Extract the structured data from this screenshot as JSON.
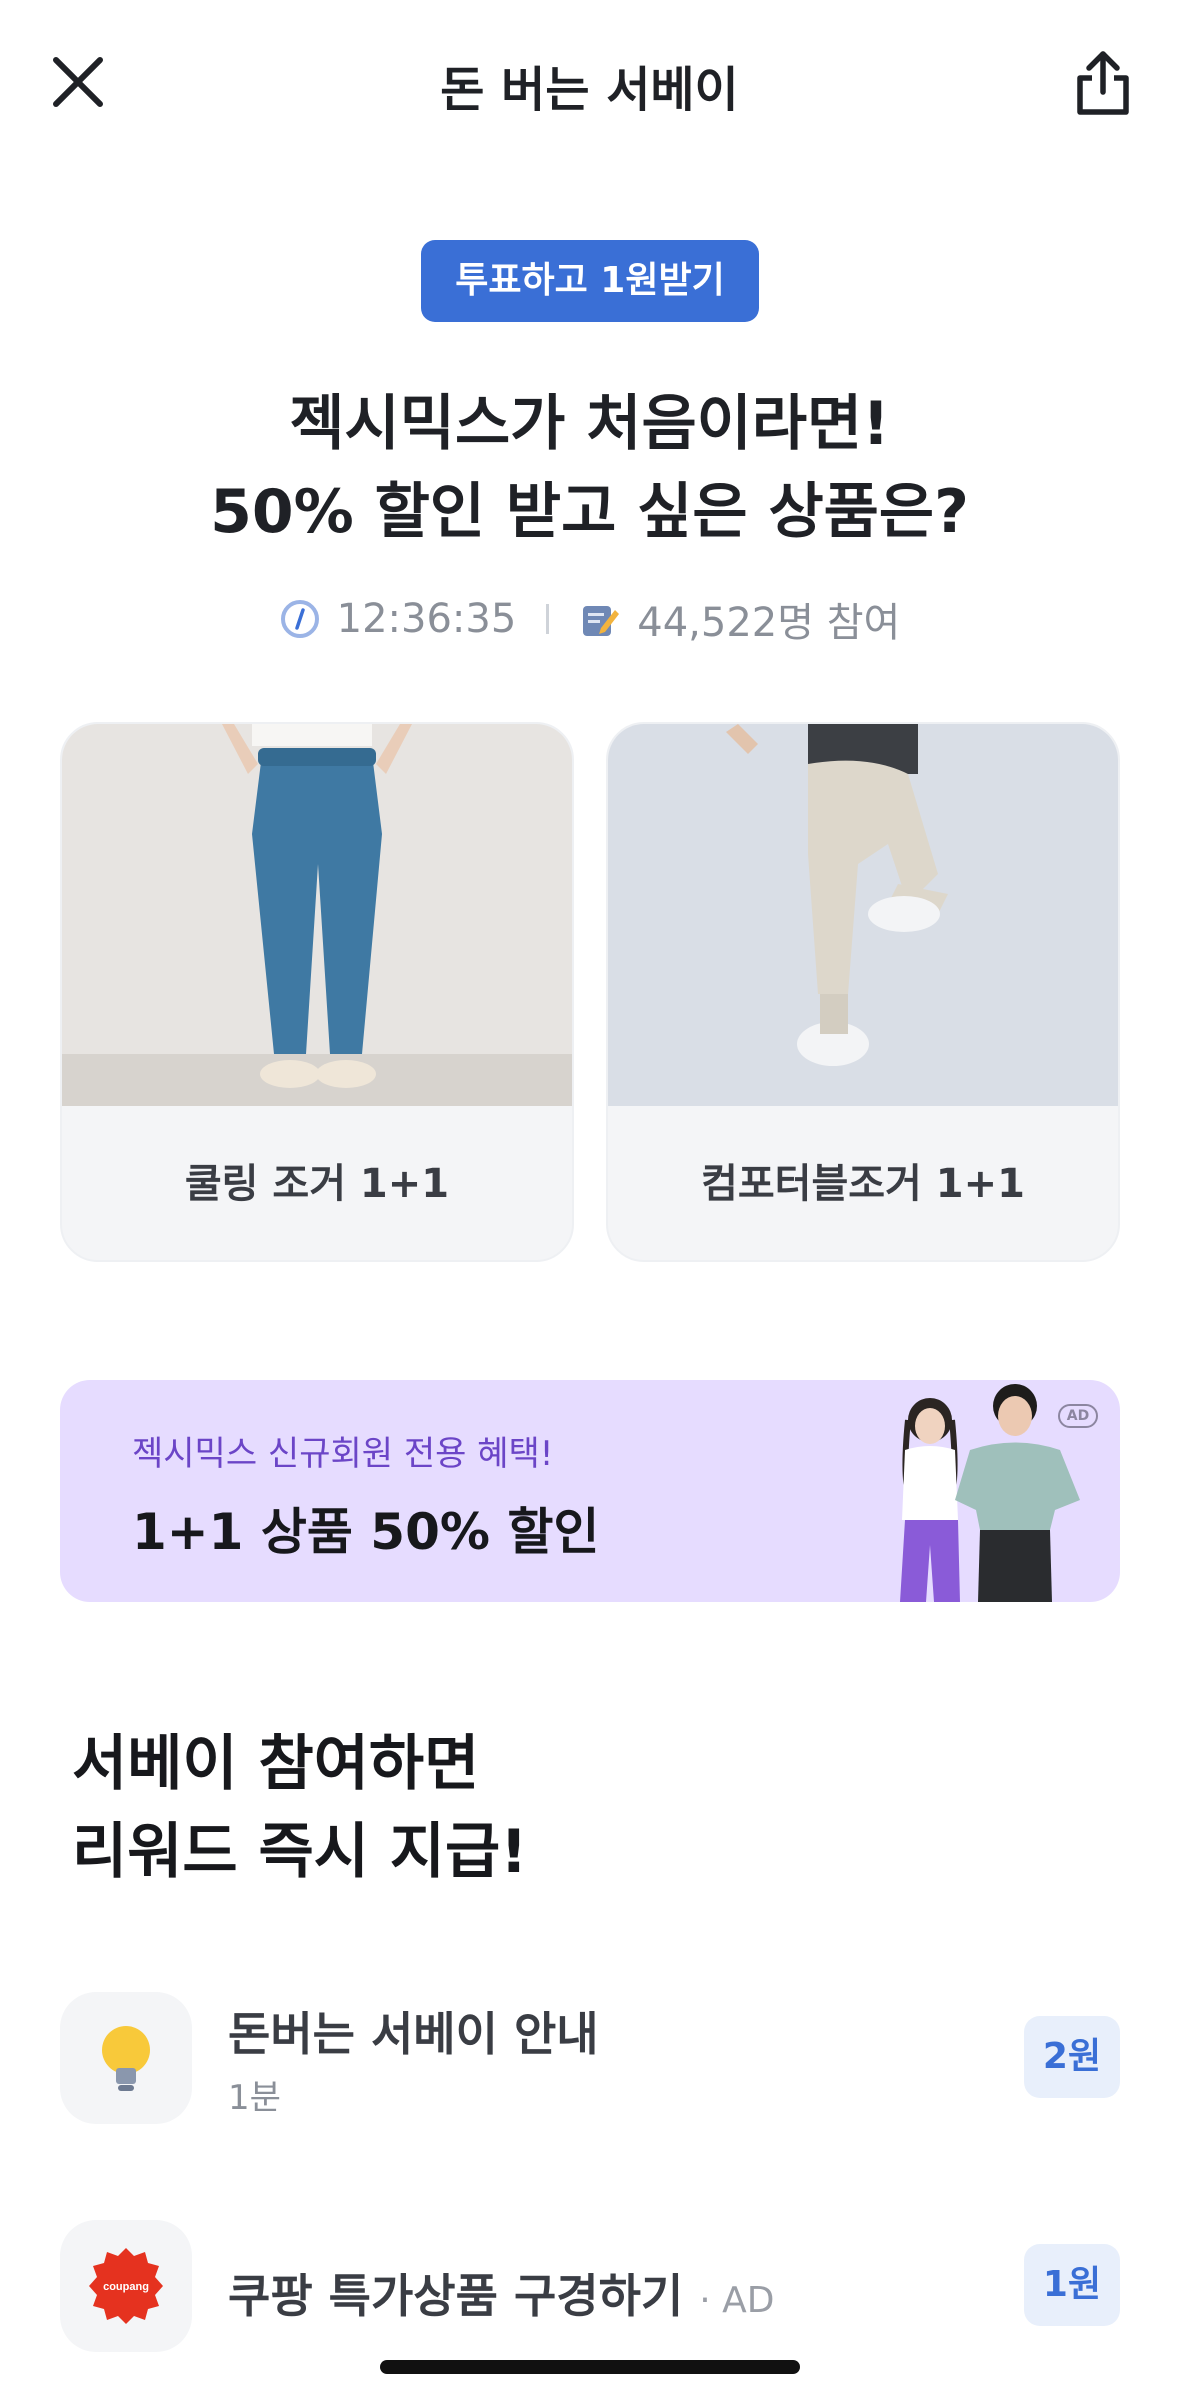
{
  "header": {
    "title": "돈 버는 서베이",
    "close_icon": "close-icon",
    "share_icon": "share-icon"
  },
  "survey": {
    "badge": "투표하고 1원받기",
    "headline_line1": "젝시믹스가 처음이라면!",
    "headline_line2": "50% 할인 받고 싶은 상품은?",
    "timer": "12:36:35",
    "participants": "44,522명 참여",
    "options": [
      {
        "label": "쿨링 조거 1+1"
      },
      {
        "label": "컴포터블조거 1+1"
      }
    ]
  },
  "ad_banner": {
    "subtitle": "젝시믹스 신규회원 전용 혜택!",
    "title": "1+1 상품 50% 할인",
    "tag": "AD"
  },
  "rewards": {
    "title_line1": "서베이 참여하면",
    "title_line2": "리워드 즉시 지급!",
    "items": [
      {
        "name": "돈버는 서베이 안내",
        "time": "1분",
        "reward": "2원",
        "icon": "lightbulb-icon"
      },
      {
        "name": "쿠팡 특가상품 구경하기",
        "suffix": "· AD",
        "reward": "1원",
        "icon": "coupang-logo-icon",
        "logo_text": "coupang"
      }
    ]
  },
  "colors": {
    "accent": "#3a6fd6",
    "ad_bg": "#e6dcff",
    "ad_sub": "#6b45c7"
  }
}
